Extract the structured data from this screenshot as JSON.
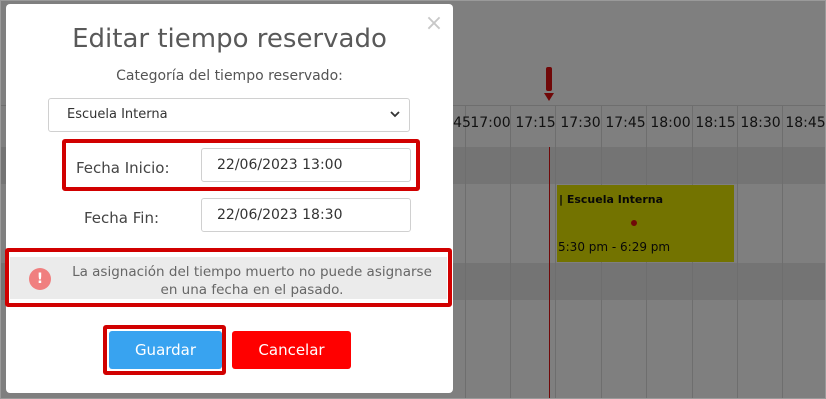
{
  "schedule": {
    "times": [
      "45",
      "17:00",
      "17:15",
      "17:30",
      "17:45",
      "18:00",
      "18:15",
      "18:30",
      "18:45"
    ],
    "event": {
      "title": "| Escuela Interna",
      "time_range": "5:30 pm - 6:29 pm",
      "color": "#e7e700"
    },
    "now_line_color": "#e01010"
  },
  "modal": {
    "title": "Editar tiempo reservado",
    "category_label": "Categoría del tiempo reservado:",
    "category_value": "Escuela Interna",
    "start_label": "Fecha Inicio:",
    "start_value": "22/06/2023 13:00",
    "end_label": "Fecha Fin:",
    "end_value": "22/06/2023 18:30",
    "alert_icon": "!",
    "alert_text": "La asignación del tiempo muerto no puede asignarse en una fecha en el pasado.",
    "save_label": "Guardar",
    "cancel_label": "Cancelar",
    "close_symbol": "×",
    "highlight_color": "#d10000"
  }
}
